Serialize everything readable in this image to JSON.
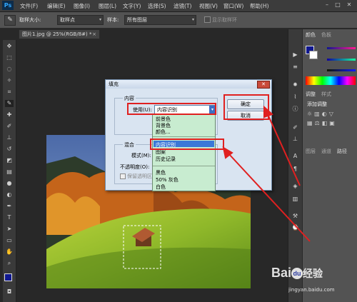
{
  "app": {
    "logo": "Ps"
  },
  "menu": [
    "文件(F)",
    "编辑(E)",
    "图像(I)",
    "图层(L)",
    "文字(Y)",
    "选择(S)",
    "滤镜(T)",
    "视图(V)",
    "窗口(W)",
    "帮助(H)"
  ],
  "options_bar": {
    "sample_size_label": "取样大小:",
    "sample_size_value": "取样点",
    "sample_label": "样本:",
    "sample_value": "所有图层",
    "show_ring_label": "显示取样环"
  },
  "document_tab": "图片1.jpg @ 25%(RGB/8#) *",
  "panels": {
    "color_tab": "颜色",
    "swatches_tab": "色板",
    "adjustments_tab": "调整",
    "styles_tab": "样式",
    "add_adjustment": "添加调整",
    "layers_tabs": [
      "图层",
      "通道",
      "路径"
    ]
  },
  "dialog": {
    "title": "填充",
    "content_group": "内容",
    "use_label": "使用(U):",
    "use_value": "内容识别",
    "ok_button": "确定",
    "cancel_button": "取消",
    "blend_group": "混合",
    "mode_label": "模式(M):",
    "opacity_label": "不透明度(O):",
    "preserve_label": "保留透明区域",
    "dropdown_items": [
      "前景色",
      "背景色",
      "颜色...",
      "内容识别",
      "图案",
      "历史记录",
      "黑色",
      "50% 灰色",
      "白色"
    ]
  },
  "watermark": {
    "brand": "Bai",
    "logo_char": "du",
    "suffix": "经验",
    "url": "jingyan.baidu.com"
  },
  "colors": {
    "highlight_red": "#e02020",
    "dropdown_bg": "#c8ecd0",
    "selected_item": "#3a78d8"
  }
}
